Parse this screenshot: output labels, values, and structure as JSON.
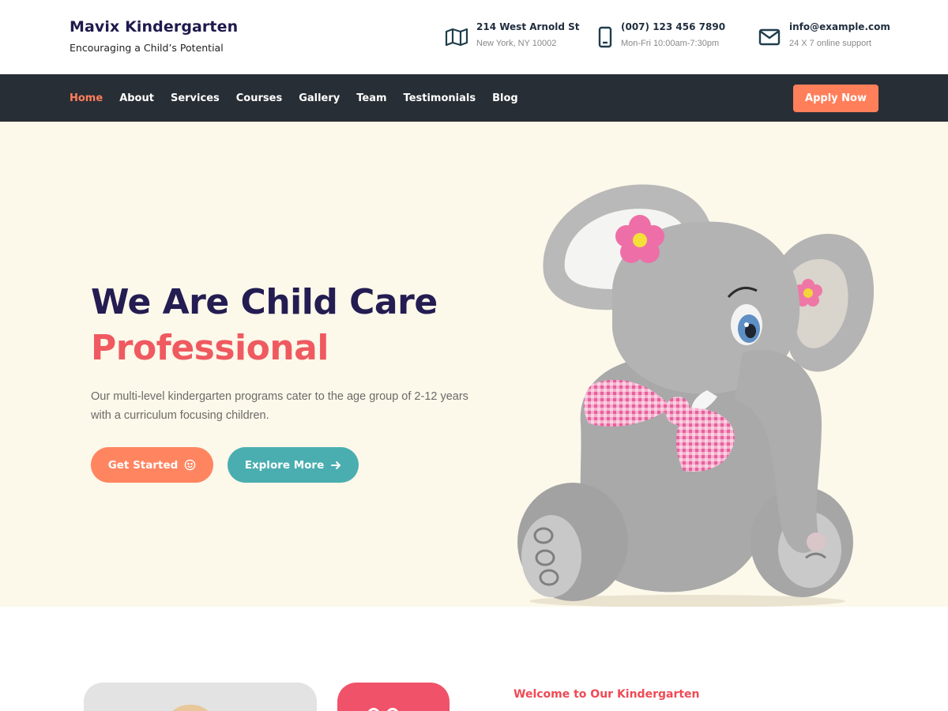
{
  "brand": {
    "title": "Mavix Kindergarten",
    "tagline": "Encouraging a Child’s Potential"
  },
  "contact": [
    {
      "icon": "map-icon",
      "title": "214 West Arnold St",
      "sub": "New York, NY 10002"
    },
    {
      "icon": "phone-icon",
      "title": "(007) 123 456 7890",
      "sub": "Mon-Fri 10:00am-7:30pm"
    },
    {
      "icon": "mail-icon",
      "title": "info@example.com",
      "sub": "24 X 7 online support"
    }
  ],
  "nav": {
    "items": [
      "Home",
      "About",
      "Services",
      "Courses",
      "Gallery",
      "Team",
      "Testimonials",
      "Blog"
    ],
    "active": "Home",
    "apply_label": "Apply Now"
  },
  "hero": {
    "heading_line1": "We Are Child Care",
    "heading_line2": "Professional",
    "description": "Our multi-level kindergarten programs cater to the age group of 2-12 years with a curriculum focusing children.",
    "primary_button": "Get Started",
    "primary_button_icon": "smile-icon",
    "secondary_button": "Explore More",
    "secondary_button_icon": "arrow-right-icon",
    "image": "elephant-plush-toy"
  },
  "about": {
    "welcome": "Welcome to Our Kindergarten"
  },
  "colors": {
    "accent": "#ff7f5a",
    "nav_bg": "#282e35",
    "hero_bg": "#fcf8ea",
    "heading": "#241d52",
    "heading_accent": "#ef5a60",
    "teal": "#4aaeb0",
    "pink": "#f0526a"
  }
}
